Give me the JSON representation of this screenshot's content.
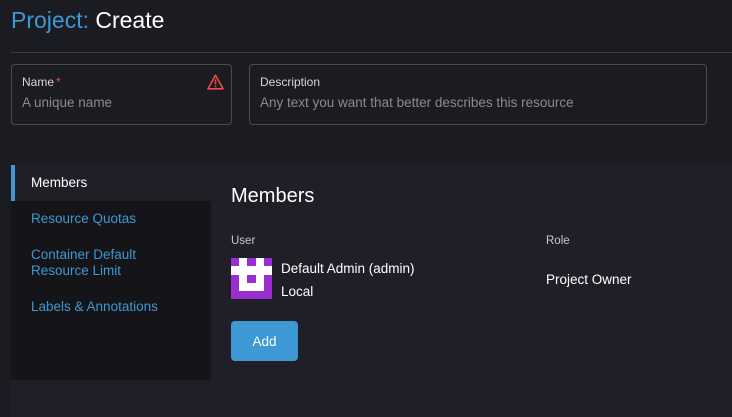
{
  "header": {
    "title_prefix": "Project:",
    "title_action": "Create"
  },
  "form": {
    "name": {
      "label": "Name",
      "required_marker": "*",
      "placeholder": "A unique name",
      "value": "",
      "status_icon": "warning-triangle-icon",
      "status_color": "#f64747"
    },
    "description": {
      "label": "Description",
      "placeholder": "Any text you want that better describes this resource",
      "value": ""
    }
  },
  "tabs": [
    {
      "label": "Members",
      "active": true
    },
    {
      "label": "Resource Quotas",
      "active": false
    },
    {
      "label": "Container Default Resource Limit",
      "active": false
    },
    {
      "label": "Labels & Annotations",
      "active": false
    }
  ],
  "members": {
    "heading": "Members",
    "columns": {
      "user": "User",
      "role": "Role"
    },
    "rows": [
      {
        "avatar_icon": "identicon-avatar",
        "display_name": "Default Admin (admin)",
        "provider": "Local",
        "role": "Project Owner"
      }
    ],
    "add_button_label": "Add"
  },
  "colors": {
    "accent": "#3d98d3",
    "background": "#1b1c21",
    "panel": "#1f2027",
    "sidebar": "#141419",
    "avatar": "#9b2ed1",
    "error": "#f64747"
  }
}
